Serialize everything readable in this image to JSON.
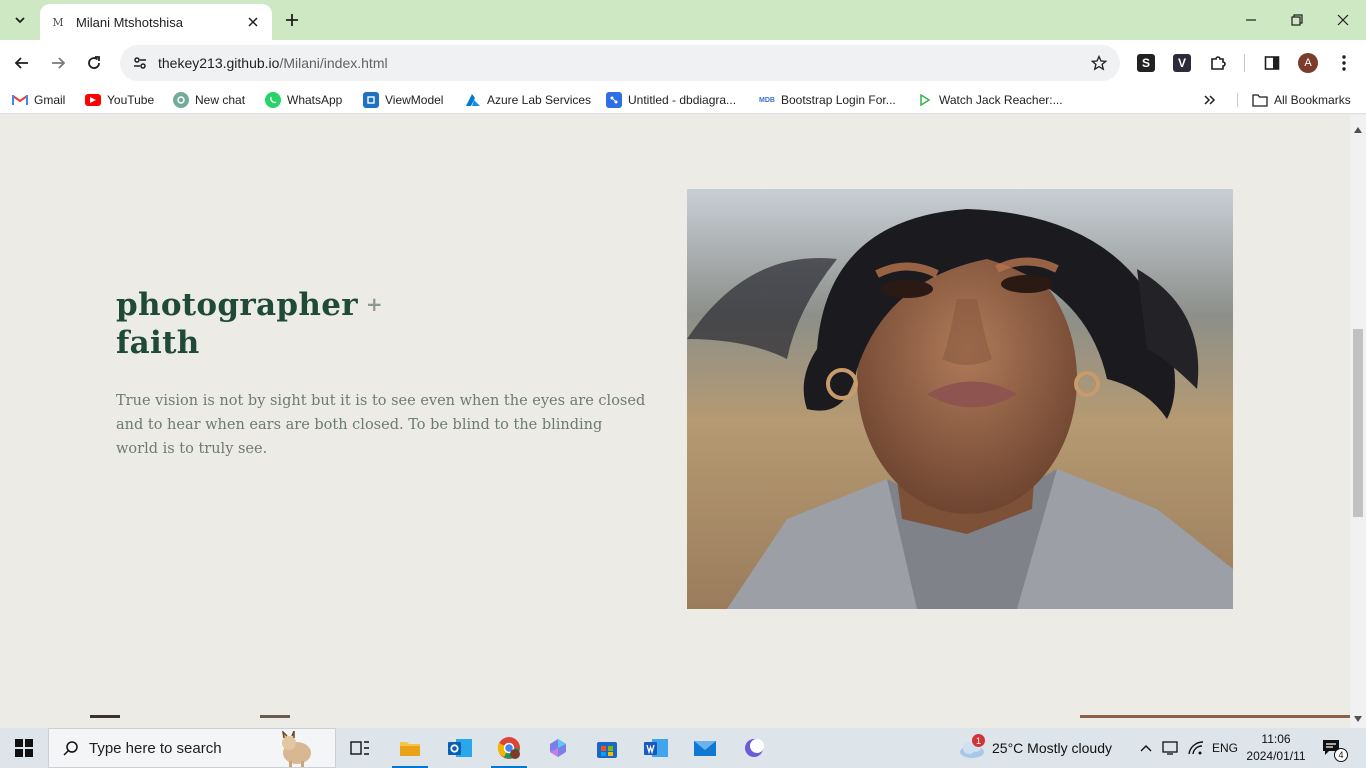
{
  "browser": {
    "tab": {
      "favicon": "M",
      "title": "Milani Mtshotshisa"
    },
    "url": {
      "domain": "thekey213.github.io",
      "path": "/Milani/index.html"
    },
    "profile_initial": "A",
    "bookmarks": [
      {
        "label": "Gmail",
        "icon": "gmail-icon",
        "color": "#ea4335"
      },
      {
        "label": "YouTube",
        "icon": "youtube-icon",
        "color": "#ff0000"
      },
      {
        "label": "New chat",
        "icon": "chatgpt-icon",
        "color": "#74aa9c"
      },
      {
        "label": "WhatsApp",
        "icon": "whatsapp-icon",
        "color": "#25d366"
      },
      {
        "label": "ViewModel",
        "icon": "viewmodel-icon",
        "color": "#1e73be"
      },
      {
        "label": "Azure Lab Services",
        "icon": "azure-icon",
        "color": "#0078d4"
      },
      {
        "label": "Untitled - dbdiagra...",
        "icon": "dbdiagram-icon",
        "color": "#2f6fe4"
      },
      {
        "label": "Bootstrap Login For...",
        "icon": "mdb-icon",
        "color": "#3b71ca"
      },
      {
        "label": "Watch Jack Reacher:...",
        "icon": "play-icon",
        "color": "#3fb950"
      }
    ],
    "all_bookmarks": "All Bookmarks"
  },
  "page": {
    "title_line1": "photographer",
    "title_plus": "+",
    "title_line2": "faith",
    "text": "True vision is not by sight but it is to see even when the eyes are closed and to hear when ears are both closed. To be blind to the blinding world is to truly see."
  },
  "taskbar": {
    "search_placeholder": "Type here to search",
    "weather_badge": "1",
    "weather": "25°C  Mostly cloudy",
    "language": "ENG",
    "time": "11:06",
    "date": "2024/01/11",
    "notification_count": "4"
  }
}
